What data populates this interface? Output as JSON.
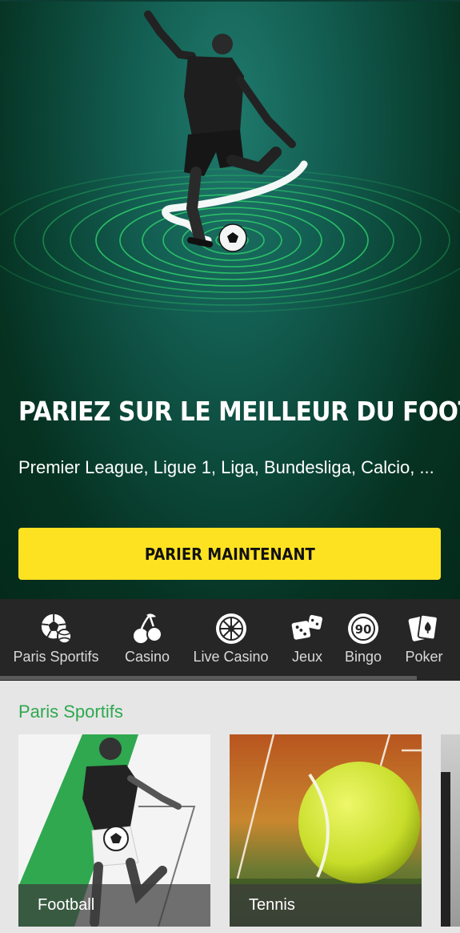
{
  "hero": {
    "title": "PARIEZ SUR LE MEILLEUR DU FOOT",
    "subtitle": "Premier League, Ligue 1, Liga, Bundesliga, Calcio, ...",
    "cta_label": "PARIER MAINTENANT"
  },
  "nav": {
    "items": [
      {
        "label": "Paris Sportifs",
        "icon": "soccer-ball-icon"
      },
      {
        "label": "Casino",
        "icon": "cherries-icon"
      },
      {
        "label": "Live Casino",
        "icon": "roulette-icon"
      },
      {
        "label": "Jeux",
        "icon": "dice-icon"
      },
      {
        "label": "Bingo",
        "icon": "bingo-ball-icon",
        "number": "90"
      },
      {
        "label": "Poker",
        "icon": "cards-icon"
      }
    ]
  },
  "section": {
    "title": "Paris Sportifs",
    "cards": [
      {
        "label": "Football"
      },
      {
        "label": "Tennis"
      }
    ]
  },
  "colors": {
    "accent_yellow": "#fde221",
    "accent_green": "#2fa84f",
    "nav_background": "#262626"
  }
}
